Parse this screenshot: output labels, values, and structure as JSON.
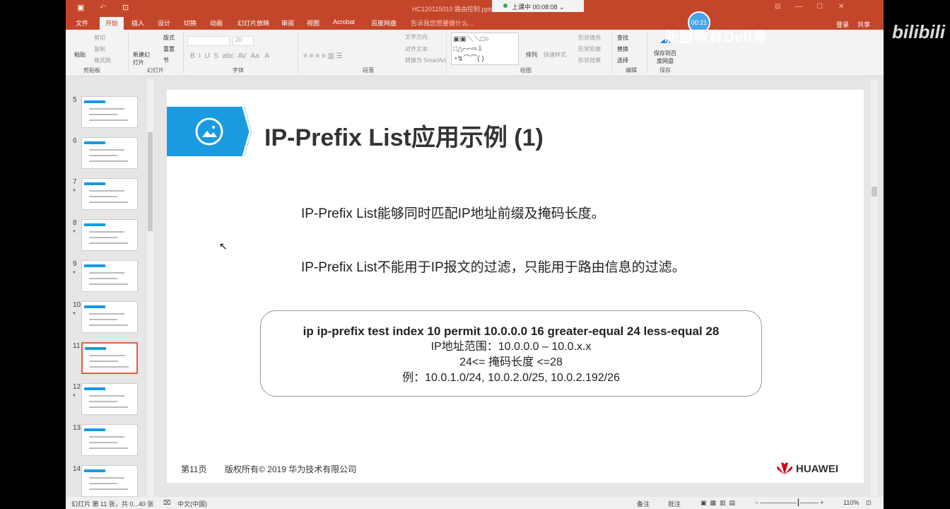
{
  "title_bar": {
    "document": "HC120115010 路由控制.pptx",
    "live_status": "上课中 00:08:08",
    "timer": "00:21"
  },
  "tabs": [
    "文件",
    "开始",
    "插入",
    "设计",
    "切换",
    "动画",
    "幻灯片放映",
    "审阅",
    "视图",
    "Acrobat",
    "百度网盘"
  ],
  "active_tab": "开始",
  "tell_me": "告诉我您想要做什么...",
  "account": {
    "login": "登录",
    "share": "共享"
  },
  "ribbon": {
    "clipboard": {
      "label": "剪贴板",
      "paste": "粘贴",
      "cut": "剪切",
      "copy": "复制",
      "format_painter": "格式刷"
    },
    "slides": {
      "label": "幻灯片",
      "new_slide": "新建幻灯片",
      "layout": "版式",
      "reset": "重置",
      "section": "节"
    },
    "font": {
      "label": "字体",
      "size": "20"
    },
    "paragraph": {
      "label": "段落",
      "text_direction": "文字方向",
      "align_text": "对齐文本",
      "smartart": "转换为 SmartArt"
    },
    "drawing": {
      "label": "绘图",
      "arrange": "排列",
      "quick_styles": "快速样式",
      "shape_fill": "形状填充",
      "shape_outline": "形状轮廓",
      "shape_effects": "形状效果"
    },
    "editing": {
      "label": "编辑",
      "find": "查找",
      "replace": "替换",
      "select": "选择"
    },
    "save": {
      "label": "保存",
      "save_to_baidu": "保存到百度网盘"
    }
  },
  "watermark": "新盟教育Dell黑",
  "bilibili": "bilibili",
  "thumbnails": [
    {
      "n": "5",
      "star": ""
    },
    {
      "n": "6",
      "star": ""
    },
    {
      "n": "7",
      "star": "*"
    },
    {
      "n": "8",
      "star": "*"
    },
    {
      "n": "9",
      "star": "*"
    },
    {
      "n": "10",
      "star": "*"
    },
    {
      "n": "11",
      "star": ""
    },
    {
      "n": "12",
      "star": "*"
    },
    {
      "n": "13",
      "star": ""
    },
    {
      "n": "14",
      "star": ""
    }
  ],
  "slide": {
    "title": "IP-Prefix List应用示例 (1)",
    "bullet1": "IP-Prefix List能够同时匹配IP地址前缀及掩码长度。",
    "bullet2": "IP-Prefix List不能用于IP报文的过滤，只能用于路由信息的过滤。",
    "code": "ip ip-prefix test index 10 permit 10.0.0.0 16 greater-equal 24 less-equal 28",
    "range": "IP地址范围：10.0.0.0 – 10.0.x.x",
    "mask": "24<= 掩码长度 <=28",
    "example": "例：10.0.1.0/24, 10.0.2.0/25, 10.0.2.192/26",
    "page": "第11页",
    "copyright": "版权所有© 2019 华为技术有限公司",
    "brand": "HUAWEI"
  },
  "status": {
    "slide_info": "幻灯片 第 11 张，共 0...40 张",
    "language": "中文(中国)",
    "notes": "备注",
    "comments": "批注",
    "zoom": "110%"
  }
}
